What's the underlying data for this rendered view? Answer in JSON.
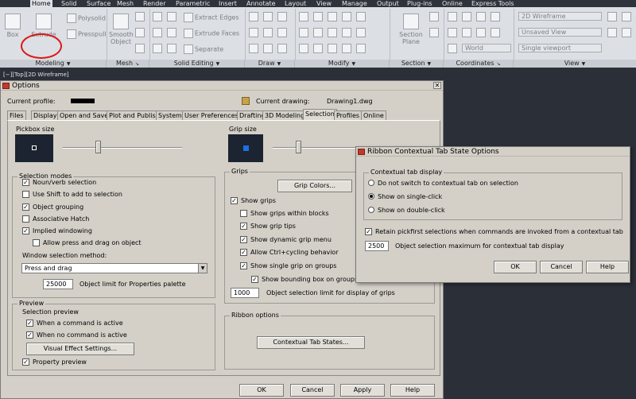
{
  "ribbon": {
    "tabs": [
      "Home",
      "Solid",
      "Surface",
      "Mesh",
      "Render",
      "Parametric",
      "Insert",
      "Annotate",
      "Layout",
      "View",
      "Manage",
      "Output",
      "Plug-ins",
      "Online",
      "Express Tools"
    ],
    "active_tab": "Home",
    "buttons": {
      "box": "Box",
      "extrude": "Extrude",
      "polysolid": "Polysolid",
      "presspull": "Presspull",
      "smooth_object_1": "Smooth",
      "smooth_object_2": "Object",
      "extract_edges": "Extract Edges",
      "extrude_faces": "Extrude Faces",
      "separate": "Separate",
      "section_plane_1": "Section",
      "section_plane_2": "Plane",
      "world": "World",
      "visual_style": "2D Wireframe",
      "unsaved_view": "Unsaved View",
      "single_viewport": "Single viewport"
    },
    "panels": [
      "Modeling",
      "Mesh",
      "Solid Editing",
      "Draw",
      "Modify",
      "Section",
      "Coordinates",
      "View"
    ]
  },
  "viewport_label": "[−][Top][2D Wireframe]",
  "options": {
    "title": "Options",
    "current_profile_label": "Current profile:",
    "current_drawing_label": "Current drawing:",
    "current_drawing_value": "Drawing1.dwg",
    "tabs": [
      "Files",
      "Display",
      "Open and Save",
      "Plot and Publish",
      "System",
      "User Preferences",
      "Drafting",
      "3D Modeling",
      "Selection",
      "Profiles",
      "Online"
    ],
    "selected_tab": "Selection",
    "pickbox_size": "Pickbox size",
    "grip_size": "Grip size",
    "selection_modes": {
      "title": "Selection modes",
      "items": [
        {
          "label": "Noun/verb selection",
          "checked": true
        },
        {
          "label": "Use Shift to add to selection",
          "checked": false
        },
        {
          "label": "Object grouping",
          "checked": true
        },
        {
          "label": "Associative Hatch",
          "checked": false
        },
        {
          "label": "Implied windowing",
          "checked": true
        },
        {
          "label": "Allow press and drag on object",
          "checked": false
        }
      ],
      "window_method_label": "Window selection method:",
      "window_method_value": "Press and drag",
      "object_limit_value": "25000",
      "object_limit_label": "Object limit for Properties palette"
    },
    "preview": {
      "title": "Preview",
      "selection_preview": "Selection preview",
      "when_active": "When a command is active",
      "when_no_command": "When no command is active",
      "visual_effect_button": "Visual Effect Settings...",
      "property_preview": "Property preview"
    },
    "grips": {
      "title": "Grips",
      "grip_colors_button": "Grip Colors...",
      "items": [
        {
          "label": "Show grips",
          "checked": true
        },
        {
          "label": "Show grips within blocks",
          "checked": false
        },
        {
          "label": "Show grip tips",
          "checked": true
        },
        {
          "label": "Show dynamic grip menu",
          "checked": true
        },
        {
          "label": "Allow Ctrl+cycling behavior",
          "checked": true
        },
        {
          "label": "Show single grip on groups",
          "checked": true
        },
        {
          "label": "Show bounding box on groups",
          "checked": true
        }
      ],
      "grip_limit_value": "1000",
      "grip_limit_label": "Object selection limit for display of grips"
    },
    "ribbon_options": {
      "title": "Ribbon options",
      "contextual_button": "Contextual Tab States..."
    },
    "buttons": {
      "ok": "OK",
      "cancel": "Cancel",
      "apply": "Apply",
      "help": "Help"
    }
  },
  "contextual": {
    "title": "Ribbon Contextual Tab State Options",
    "group_title": "Contextual tab display",
    "radios": [
      {
        "label": "Do not switch to contextual tab on selection",
        "selected": false
      },
      {
        "label": "Show on single-click",
        "selected": true
      },
      {
        "label": "Show on double-click",
        "selected": false
      }
    ],
    "retain_label": "Retain pickfirst selections when commands are invoked from a contextual tab",
    "retain_checked": true,
    "max_value": "2500",
    "max_label": "Object selection maximum for contextual tab display",
    "buttons": {
      "ok": "OK",
      "cancel": "Cancel",
      "help": "Help"
    }
  }
}
